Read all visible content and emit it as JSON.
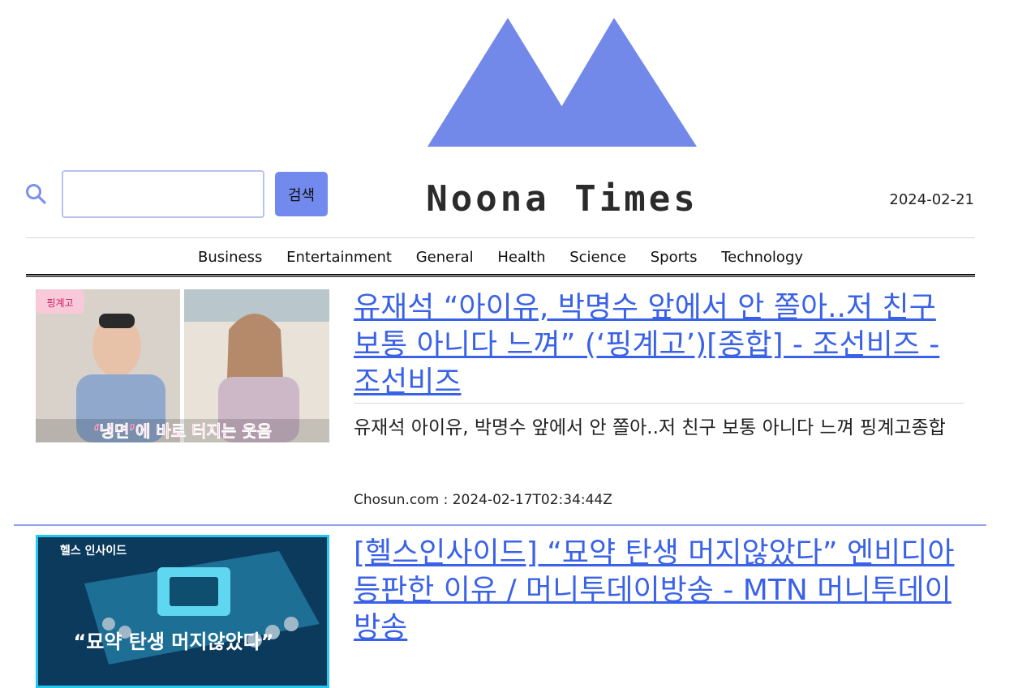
{
  "colors": {
    "accent": "#7289ee",
    "link": "#3a62e8",
    "separator": "#8fa2ea"
  },
  "search": {
    "placeholder": "",
    "value": "",
    "button_label": "검색",
    "icon": "search-icon"
  },
  "header": {
    "logo_icon": "mountain-logo",
    "title": "Noona Times",
    "date": "2024-02-21"
  },
  "nav": {
    "items": [
      {
        "label": "Business"
      },
      {
        "label": "Entertainment"
      },
      {
        "label": "General"
      },
      {
        "label": "Health"
      },
      {
        "label": "Science"
      },
      {
        "label": "Sports"
      },
      {
        "label": "Technology"
      }
    ]
  },
  "articles": [
    {
      "title": "유재석 “아이유, 박명수 앞에서 안 쫄아..저 친구 보통 아니다 느껴” (‘핑계고’)[종합] - 조선비즈 - 조선비즈",
      "description": "유재석 아이유, 박명수 앞에서 안 쫄아..저 친구 보통 아니다 느껴 핑계고종합",
      "source": "Chosun.com",
      "separator": ":",
      "published": "2024-02-17T02:34:44Z",
      "thumb_caption": "‘냉면’에 바로 터지는 웃음",
      "thumb_badge": "핑계고"
    },
    {
      "title": "[헬스인사이드] “묘약 탄생 머지않았다” 엔비디아 등판한 이유 / 머니투데이방송 - MTN 머니투데이방송",
      "thumb_badge": "헬스 인사이드",
      "thumb_caption": "“묘약 탄생 머지않았다”"
    }
  ]
}
